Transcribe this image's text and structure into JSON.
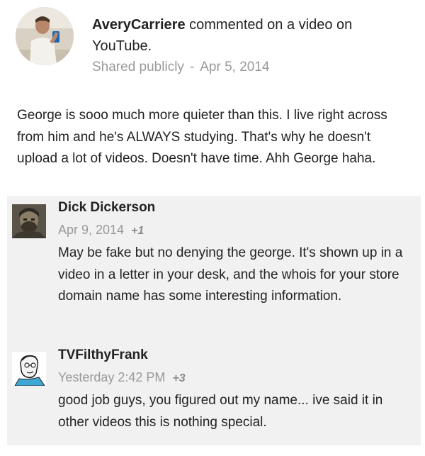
{
  "post": {
    "author": "AveryCarriere",
    "action": " commented on a video on YouTube.",
    "visibility": "Shared publicly",
    "separator": "-",
    "date": "Apr 5, 2014",
    "body": "George is sooo much more quieter than this. I live right across from him and he's ALWAYS studying. That's why he doesn't upload a lot of videos. Doesn't have time. Ahh George haha."
  },
  "comments": [
    {
      "author": "Dick Dickerson",
      "date": "Apr 9, 2014",
      "plus": "+1",
      "text": "May be fake but no denying the george. It's shown up in a video in a letter in your desk, and the whois for your store domain name has some interesting information."
    },
    {
      "author": "TVFilthyFrank",
      "date": "Yesterday 2:42 PM",
      "plus": "+3",
      "text": "good job guys, you figured out my name... ive said it in other videos this is nothing special."
    }
  ],
  "colors": {
    "meta": "#9a9a9a",
    "comment_background": "#f1f1f1",
    "text": "#222222"
  }
}
